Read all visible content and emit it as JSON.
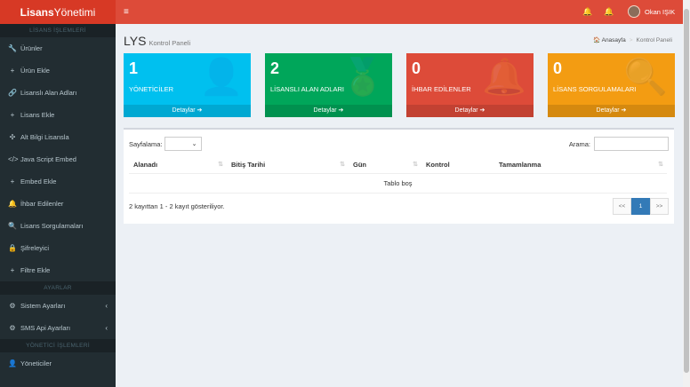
{
  "brand": {
    "bold": "Lisans",
    "normal": "Yönetimi"
  },
  "sidebar": {
    "section1": "LİSANS İŞLEMLERİ",
    "items1": [
      {
        "icon": "wrench-icon",
        "glyph": "🔧",
        "label": "Ürünler"
      },
      {
        "icon": "plus-icon",
        "glyph": "+",
        "label": "Ürün Ekle"
      },
      {
        "icon": "link-icon",
        "glyph": "🔗",
        "label": "Lisanslı Alan Adları"
      },
      {
        "icon": "plus-icon",
        "glyph": "+",
        "label": "Lisans Ekle"
      },
      {
        "icon": "arrows-icon",
        "glyph": "✣",
        "label": "Alt Bilgi Lisansla"
      },
      {
        "icon": "code-icon",
        "glyph": "</>",
        "label": "Java Script Embed"
      },
      {
        "icon": "plus-icon",
        "glyph": "+",
        "label": "Embed Ekle"
      },
      {
        "icon": "bell-icon",
        "glyph": "🔔",
        "label": "İhbar Edilenler"
      },
      {
        "icon": "search-icon",
        "glyph": "🔍",
        "label": "Lisans Sorgulamaları"
      },
      {
        "icon": "lock-icon",
        "glyph": "🔒",
        "label": "Şifreleyici"
      },
      {
        "icon": "plus-icon",
        "glyph": "+",
        "label": "Filtre Ekle"
      }
    ],
    "section2": "AYARLAR",
    "items2": [
      {
        "icon": "cogs-icon",
        "glyph": "⚙",
        "label": "Sistem Ayarları",
        "chev": "‹"
      },
      {
        "icon": "cogs-icon",
        "glyph": "⚙",
        "label": "SMS Api Ayarları",
        "chev": "‹"
      }
    ],
    "section3": "YÖNETİCİ İŞLEMLERİ",
    "items3": [
      {
        "icon": "user-icon",
        "glyph": "👤",
        "label": "Yöneticiler"
      }
    ]
  },
  "topbar": {
    "menu_glyph": "≡",
    "bell_glyph": "🔔",
    "user_name": "Okan IŞIK"
  },
  "page": {
    "title": "LYS",
    "subtitle": "Kontrol Paneli"
  },
  "breadcrumb": {
    "home": "Anasayfa",
    "current": "Kontrol Paneli",
    "home_glyph": "🏠"
  },
  "boxes": [
    {
      "num": "1",
      "label": "YÖNETİCİLER",
      "footer": "Detaylar ➔",
      "color": "#00c0ef",
      "icon": "user-plus-icon",
      "glyph": "👤"
    },
    {
      "num": "2",
      "label": "LİSANSLI ALAN ADLARI",
      "footer": "Detaylar ➔",
      "color": "#00a65a",
      "icon": "medal-icon",
      "glyph": "🏅"
    },
    {
      "num": "0",
      "label": "İHBAR EDİLENLER",
      "footer": "Detaylar ➔",
      "color": "#dd4b39",
      "icon": "bell-icon",
      "glyph": "🔔"
    },
    {
      "num": "0",
      "label": "LİSANS SORGULAMALARI",
      "footer": "Detaylar ➔",
      "color": "#f39c12",
      "icon": "search-icon",
      "glyph": "🔍"
    }
  ],
  "table": {
    "length_label": "Sayfalama:",
    "search_label": "Arama:",
    "columns": [
      "Alanadı",
      "Bitiş Tarihi",
      "Gün",
      "Kontrol",
      "Tamamlanma"
    ],
    "empty": "Tablo boş",
    "info": "2 kayıttan 1 - 2 kayıt gösteriliyor.",
    "pagination": {
      "prev": "<<",
      "current": "1",
      "next": ">>"
    }
  }
}
